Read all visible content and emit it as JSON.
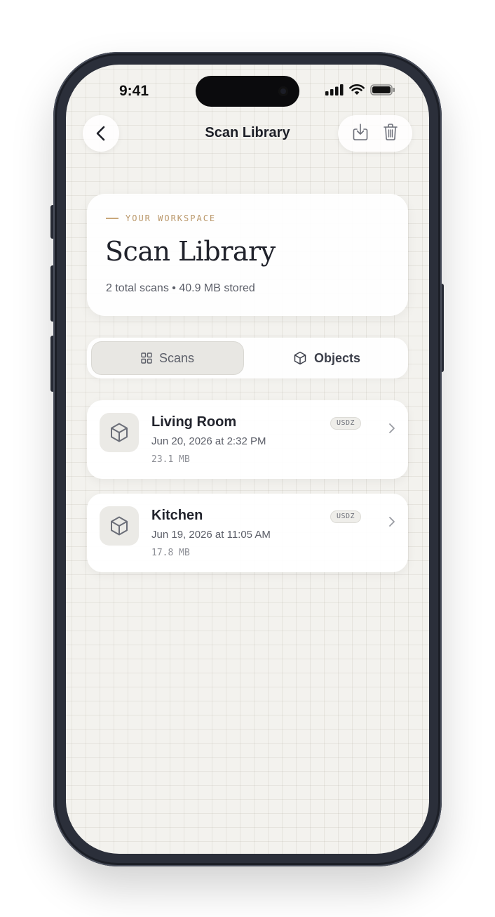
{
  "status_bar": {
    "time": "9:41"
  },
  "nav": {
    "title": "Scan Library",
    "back_icon": "chevron-left-icon",
    "action_icons": [
      "download-icon",
      "trash-icon"
    ]
  },
  "header": {
    "eyebrow": "YOUR WORKSPACE",
    "title": "Scan Library",
    "stats": "2 total scans • 40.9 MB stored"
  },
  "tabs": [
    {
      "label": "Scans",
      "icon": "grid-icon",
      "selected": true
    },
    {
      "label": "Objects",
      "icon": "cube-icon",
      "selected": false
    }
  ],
  "scans": [
    {
      "name": "Living Room",
      "date": "Jun 20, 2026 at 2:32 PM",
      "size": "23.1 MB",
      "format": "USDZ"
    },
    {
      "name": "Kitchen",
      "date": "Jun 19, 2026 at 11:05 AM",
      "size": "17.8 MB",
      "format": "USDZ"
    }
  ],
  "colors": {
    "background": "#f3f2ee",
    "accent": "#c9a77a",
    "text_primary": "#1f2230",
    "text_secondary": "#5b5e68"
  }
}
